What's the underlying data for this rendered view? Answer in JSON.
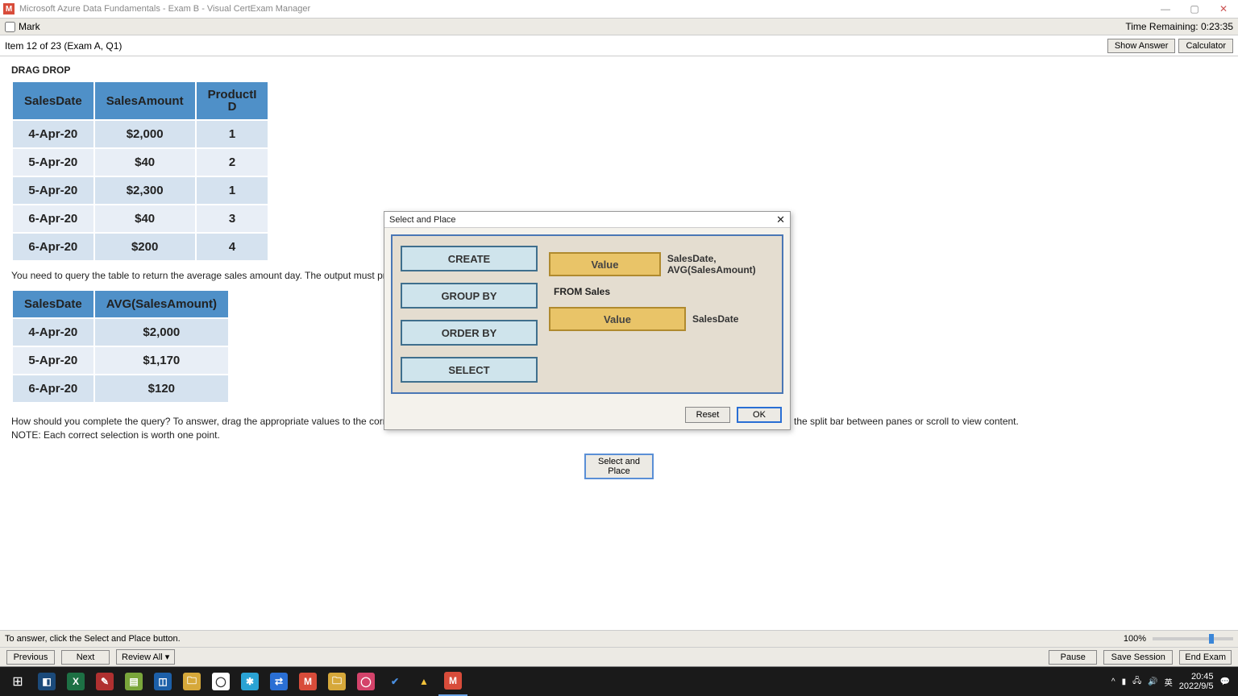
{
  "titlebar": {
    "app_icon": "M",
    "title": "Microsoft Azure Data Fundamentals - Exam B - Visual CertExam Manager"
  },
  "markbar": {
    "label": "Mark",
    "time_remaining_label": "Time Remaining: 0:23:35"
  },
  "itemrow": {
    "item_label": "Item 12 of 23  (Exam A, Q1)",
    "show_answer": "Show Answer",
    "calculator": "Calculator"
  },
  "question": {
    "drag_drop": "DRAG DROP",
    "table1": {
      "headers": [
        "SalesDate",
        "SalesAmount",
        "ProductID"
      ],
      "rows": [
        [
          "4-Apr-20",
          "$2,000",
          "1"
        ],
        [
          "5-Apr-20",
          "$40",
          "2"
        ],
        [
          "5-Apr-20",
          "$2,300",
          "1"
        ],
        [
          "6-Apr-20",
          "$40",
          "3"
        ],
        [
          "6-Apr-20",
          "$200",
          "4"
        ]
      ]
    },
    "line1": "You need to query the table to return the average sales amount day. The output must produce the following",
    "table2": {
      "headers": [
        "SalesDate",
        "AVG(SalesAmount)"
      ],
      "rows": [
        [
          "4-Apr-20",
          "$2,000"
        ],
        [
          "5-Apr-20",
          "$1,170"
        ],
        [
          "6-Apr-20",
          "$120"
        ]
      ]
    },
    "instr1": "How should you complete the query? To answer, drag the appropriate values to the correct targets. Each value may be used once, more than once, or not at all. You may need to drag the split bar between panes or scroll to view content.",
    "instr2": "NOTE: Each correct selection is worth one point.",
    "sp_button": "Select and Place"
  },
  "dialog": {
    "title": "Select and Place",
    "sources": [
      "CREATE",
      "GROUP BY",
      "ORDER BY",
      "SELECT"
    ],
    "targets": {
      "drop1": "Value",
      "text1": "SalesDate, AVG(SalesAmount)",
      "from": "FROM Sales",
      "drop2": "Value",
      "text2": "SalesDate"
    },
    "reset": "Reset",
    "ok": "OK"
  },
  "hint": {
    "text": "To answer, click the Select and Place button.",
    "zoom": "100%"
  },
  "nav": {
    "previous": "Previous",
    "next": "Next",
    "review": "Review All  ▾",
    "pause": "Pause",
    "save": "Save Session",
    "end": "End Exam"
  },
  "tray": {
    "ime": "英",
    "time": "20:45",
    "date": "2022/9/5"
  }
}
